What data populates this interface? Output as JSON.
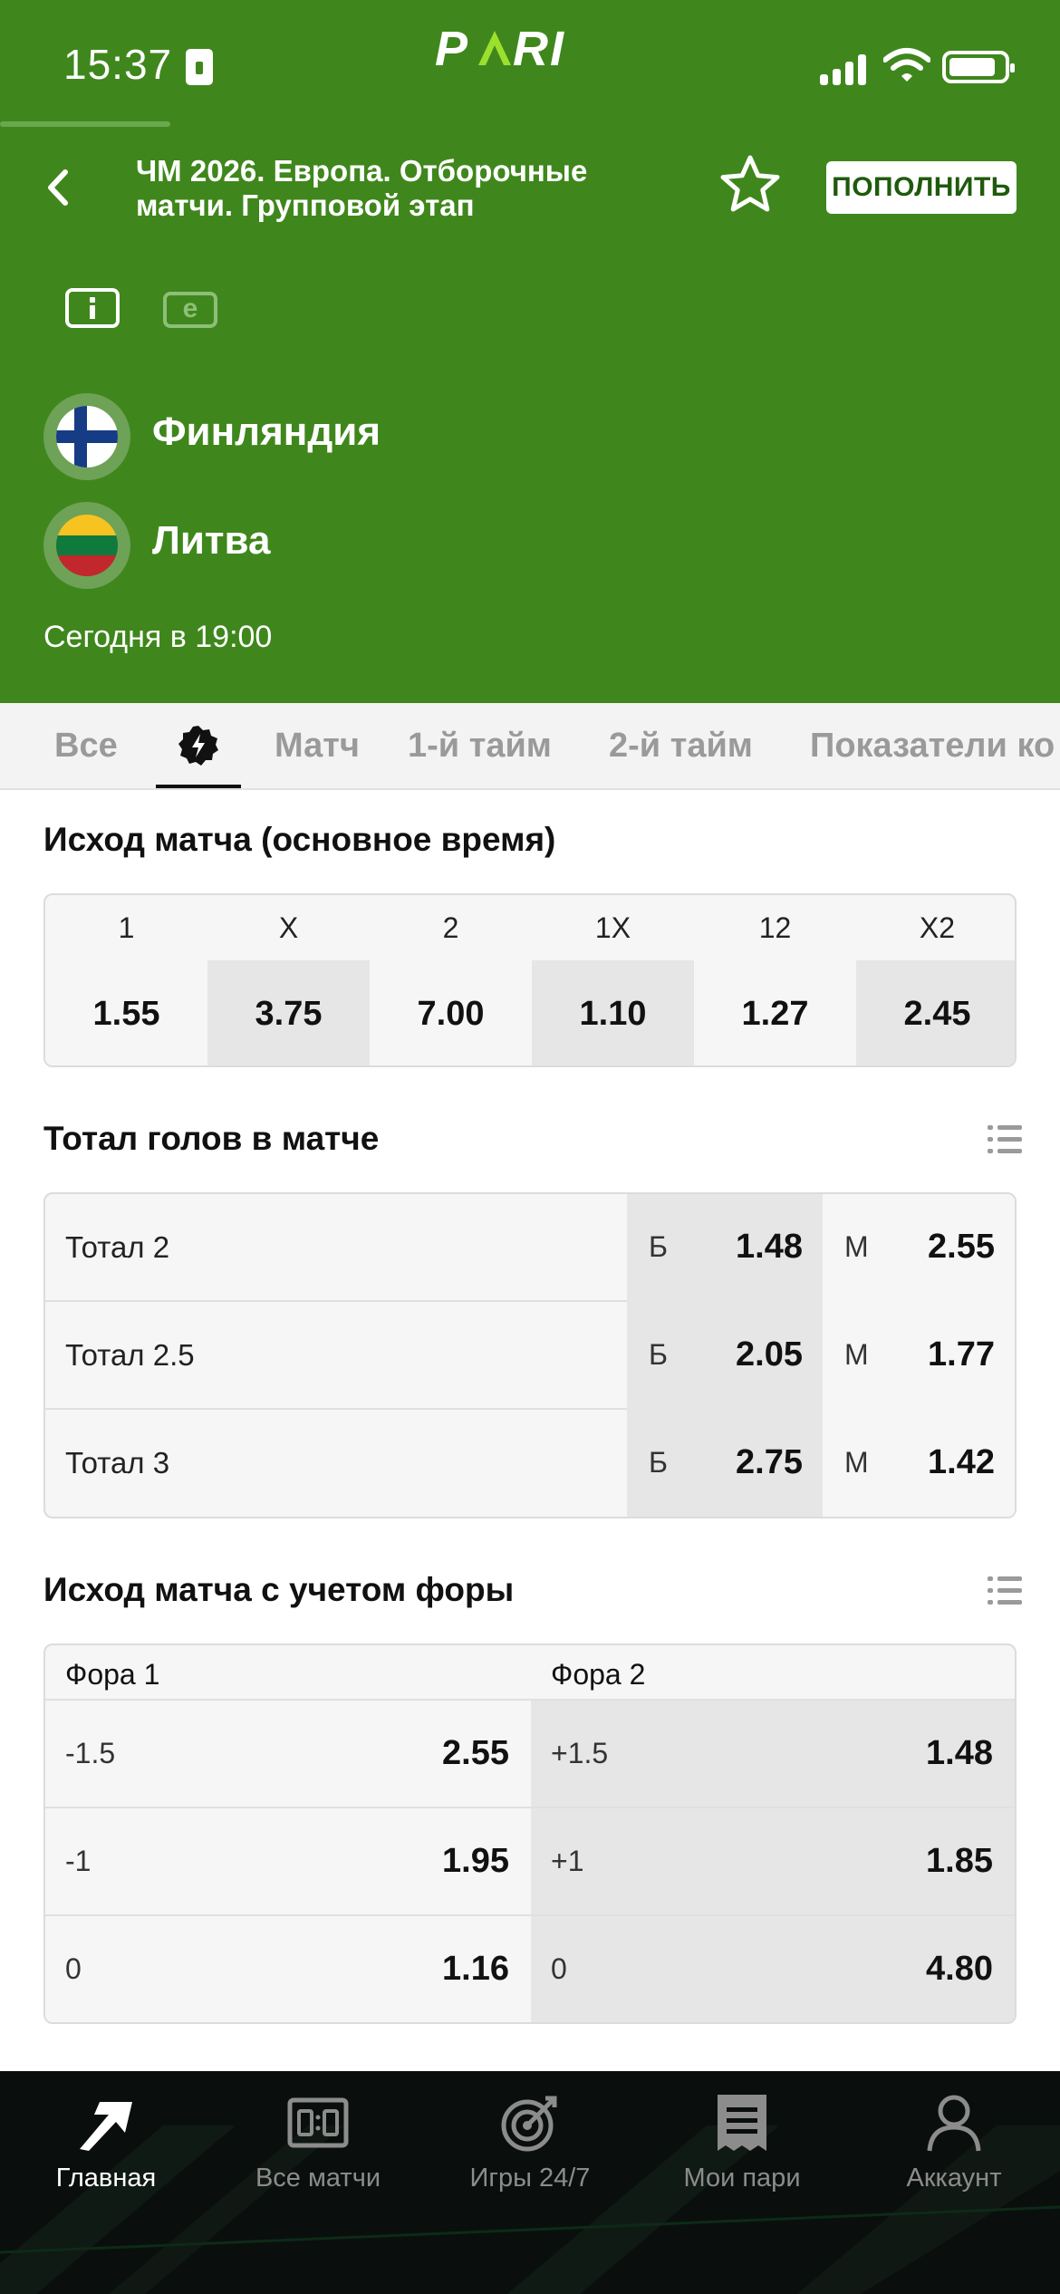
{
  "status_bar": {
    "time": "15:37",
    "brand": "PARI"
  },
  "header": {
    "title": "ЧМ 2026. Европа. Отборочные матчи. Групповой этап",
    "deposit_label": "ПОПОЛНИТЬ",
    "stats_icon_glyph": "е"
  },
  "match": {
    "team1": "Финляндия",
    "team2": "Литва",
    "start_time": "Сегодня в 19:00"
  },
  "tabs": [
    "Все",
    "Матч",
    "1-й тайм",
    "2-й тайм",
    "Показатели ко"
  ],
  "main_outcome": {
    "title": "Исход матча (основное время)",
    "columns": [
      {
        "label": "1",
        "odd": "1.55"
      },
      {
        "label": "X",
        "odd": "3.75"
      },
      {
        "label": "2",
        "odd": "7.00"
      },
      {
        "label": "1X",
        "odd": "1.10"
      },
      {
        "label": "12",
        "odd": "1.27"
      },
      {
        "label": "X2",
        "odd": "2.45"
      }
    ]
  },
  "totals": {
    "title": "Тотал голов в матче",
    "over_letter": "Б",
    "under_letter": "М",
    "rows": [
      {
        "label": "Тотал 2",
        "over": "1.48",
        "under": "2.55"
      },
      {
        "label": "Тотал 2.5",
        "over": "2.05",
        "under": "1.77"
      },
      {
        "label": "Тотал 3",
        "over": "2.75",
        "under": "1.42"
      }
    ]
  },
  "handicap": {
    "title": "Исход матча с учетом форы",
    "col1_header": "Фора 1",
    "col2_header": "Фора 2",
    "rows": [
      {
        "line1": "-1.5",
        "odd1": "2.55",
        "line2": "+1.5",
        "odd2": "1.48"
      },
      {
        "line1": "-1",
        "odd1": "1.95",
        "line2": "+1",
        "odd2": "1.85"
      },
      {
        "line1": "0",
        "odd1": "1.16",
        "line2": "0",
        "odd2": "4.80"
      }
    ]
  },
  "bottom_nav": [
    {
      "label": "Главная",
      "icon": "home-arrow-icon",
      "active": true
    },
    {
      "label": "Все матчи",
      "icon": "scoreboard-icon",
      "active": false
    },
    {
      "label": "Игры 24/7",
      "icon": "target-icon",
      "active": false
    },
    {
      "label": "Мои пари",
      "icon": "receipt-icon",
      "active": false
    },
    {
      "label": "Аккаунт",
      "icon": "person-icon",
      "active": false
    }
  ],
  "colors": {
    "header_green": "#3f871c",
    "nav_background": "#0a0f0d",
    "odds_cell_shade": "#e6e6e6"
  }
}
